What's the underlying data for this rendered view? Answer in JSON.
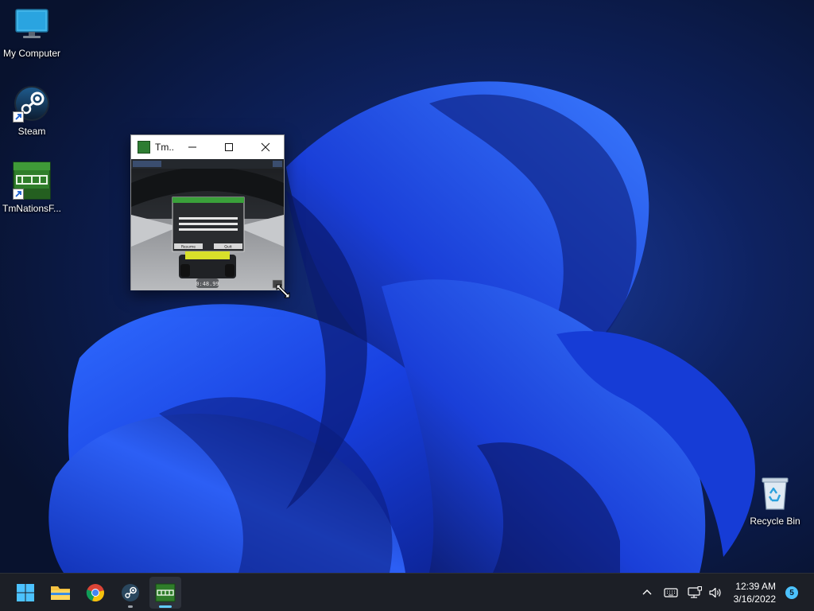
{
  "desktop": {
    "icons": [
      {
        "label": "My Computer",
        "icon": "monitor-icon"
      },
      {
        "label": "Steam",
        "icon": "steam-icon"
      },
      {
        "label": "TmNationsF...",
        "icon": "tmnations-icon"
      },
      {
        "label": "Recycle Bin",
        "icon": "recycle-bin-icon"
      }
    ]
  },
  "game_window": {
    "title": "Tm...",
    "buttons": {
      "minimize": "minimize-icon",
      "maximize": "maximize-icon",
      "close": "close-icon"
    },
    "timer": "0:48.99",
    "menu_buttons": [
      "Resume",
      "Quit"
    ]
  },
  "taskbar": {
    "apps": [
      {
        "name": "start",
        "icon": "windows-start-icon"
      },
      {
        "name": "file-explorer",
        "icon": "folder-icon"
      },
      {
        "name": "chrome",
        "icon": "chrome-icon"
      },
      {
        "name": "steam",
        "icon": "steam-icon"
      },
      {
        "name": "tmnations",
        "icon": "tmnations-icon"
      }
    ],
    "tray": {
      "time": "12:39 AM",
      "date": "3/16/2022",
      "notifications": "5"
    }
  },
  "colors": {
    "accent": "#60cdff",
    "wallpaper_bloom": "#1a4dff",
    "taskbar": "#1c1f26"
  }
}
